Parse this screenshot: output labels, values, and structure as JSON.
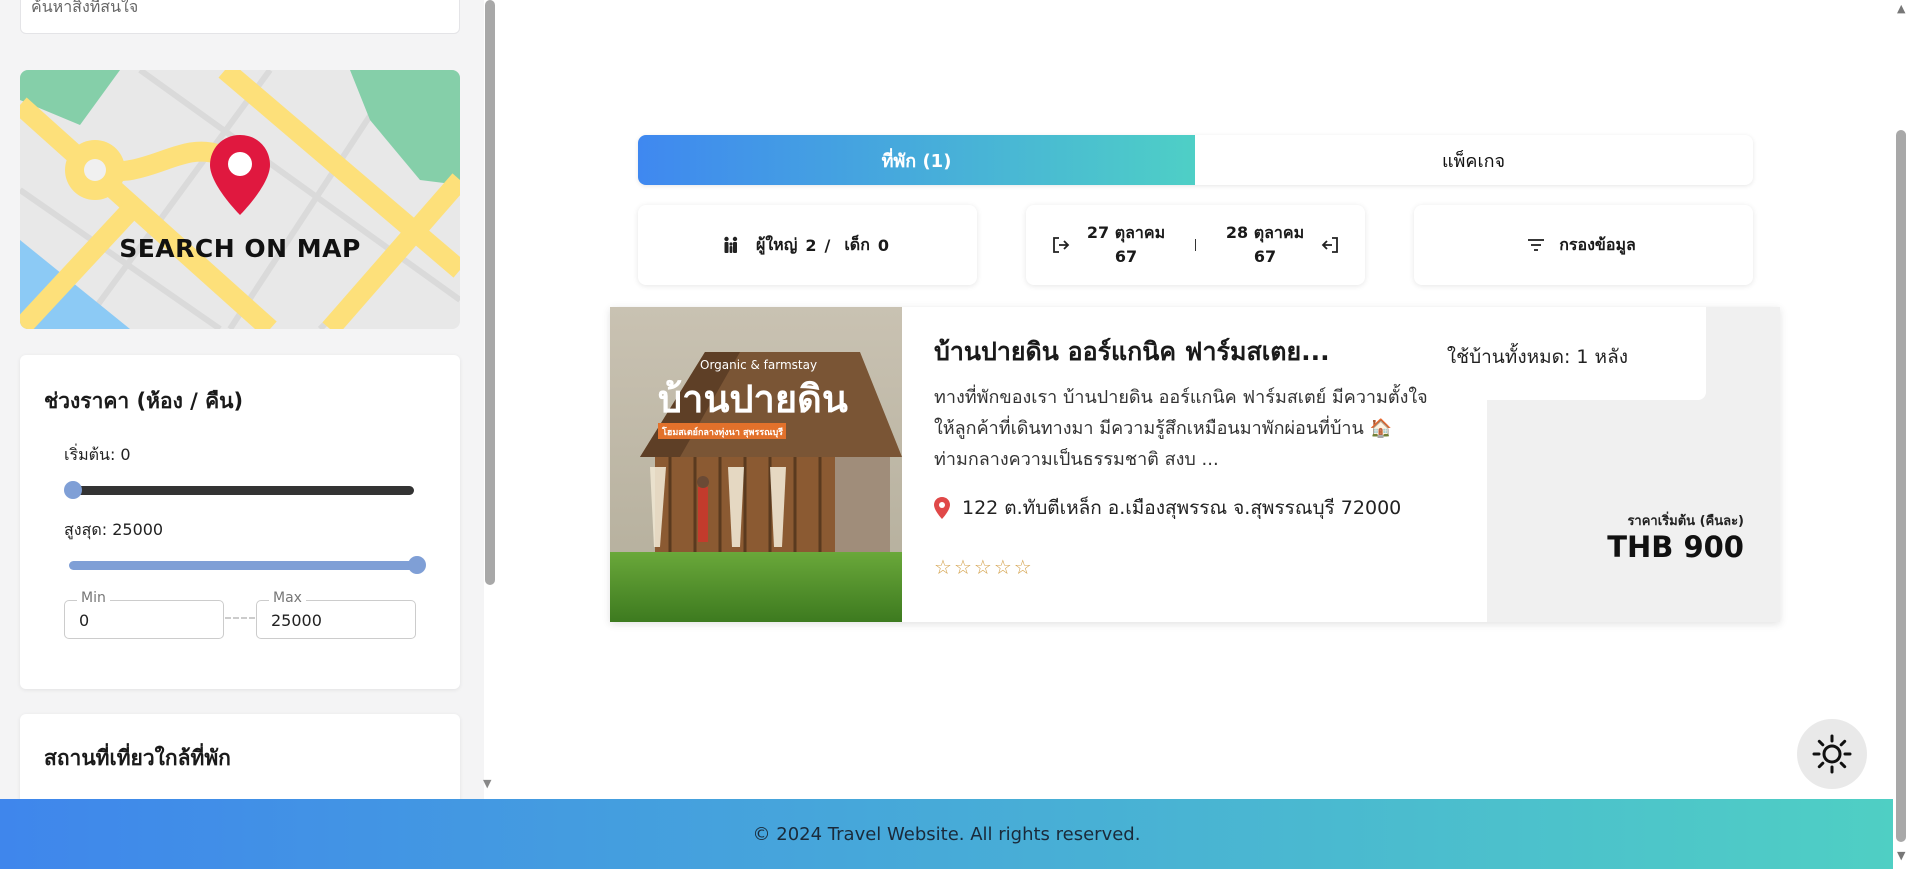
{
  "sidebar": {
    "search_placeholder": "ค้นหาสิ่งที่สนใจ",
    "map_button_label": "SEARCH ON MAP",
    "price_range": {
      "title": "ช่วงราคา (ห้อง / คืน)",
      "start_label": "เริ่มต้น: 0",
      "max_label": "สูงสุด: 25000",
      "min_slider_value": 0,
      "max_slider_value": 25000,
      "min_field_legend": "Min",
      "min_field_value": "0",
      "max_field_legend": "Max",
      "max_field_value": "25000"
    },
    "nearby_title": "สถานที่เที่ยวใกล้ที่พัก"
  },
  "tabs": [
    {
      "label": "ที่พัก (1)",
      "active": true
    },
    {
      "label": "แพ็คเกจ",
      "active": false
    }
  ],
  "search_filters": {
    "adults_label": "ผู้ใหญ่",
    "adults_count": "2",
    "separator": "/",
    "children_label": "เด็ก",
    "children_count": "0",
    "checkin_date_line1": "27 ตุลาคม",
    "checkin_date_line2": "67",
    "checkout_date_line1": "28 ตุลาคม",
    "checkout_date_line2": "67",
    "filter_label": "กรองข้อมูล"
  },
  "results": [
    {
      "title": "บ้านปายดิน ออร์แกนิค ฟาร์มสเตย...",
      "description": "ทางที่พักของเรา บ้านปายดิน ออร์แกนิค ฟาร์มสเตย์ มีความตั้งใจให้ลูกค้าที่เดินทางมา มีความรู้สึกเหมือนมาพักผ่อนที่บ้าน 🏠 ท่ามกลางความเป็นธรรมชาติ สงบ ...",
      "address": "122 ต.ทับตีเหล็ก อ.เมืองสุพรรณ จ.สุพรรณบุรี 72000",
      "rating": 0,
      "rating_max": 5,
      "accommodation_type": "ใช้บ้านทั้งหมด: 1 หลัง",
      "price_caption": "ราคาเริ่มต้น (คืนละ)",
      "price": "THB 900",
      "image_overlay": {
        "tagline": "Organic & farmstay",
        "name": "บ้านปายดิน",
        "subtitle": "โฮมสเตย์กลางทุ่งนา สุพรรณบุรี"
      }
    }
  ],
  "footer_text": "© 2024 Travel Website. All rights reserved.",
  "colors": {
    "gradient_start": "#3f88f0",
    "gradient_end": "#4ecfc6",
    "map_pin": "#e0183f",
    "star": "#d4a24c"
  },
  "icons": {
    "guests": "people-icon",
    "checkin": "login-icon",
    "checkout": "logout-icon",
    "filter": "filter-icon",
    "location": "location-pin-icon",
    "theme": "sun-icon"
  }
}
